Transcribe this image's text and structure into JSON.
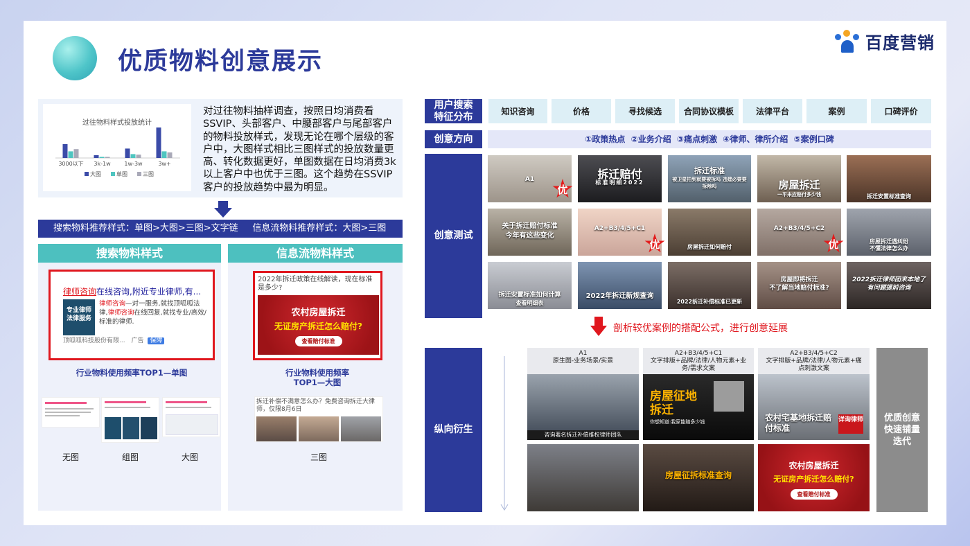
{
  "title": "优质物料创意展示",
  "logo": {
    "text": "百度营销"
  },
  "mini_chart": {
    "title": "过往物料样式投放统计",
    "legend": [
      "大图",
      "单图",
      "三图"
    ],
    "colors": [
      "#3b4ba8",
      "#4fc5c0",
      "#a9a9b8"
    ]
  },
  "chart_data": {
    "type": "bar",
    "title": "过往物料样式投放统计",
    "categories": [
      "3000以下",
      "3k-1w",
      "1w-3w",
      "3w+"
    ],
    "series": [
      {
        "name": "大图",
        "values": [
          25,
          5,
          17,
          55
        ]
      },
      {
        "name": "单图",
        "values": [
          12,
          2,
          7,
          12
        ]
      },
      {
        "name": "三图",
        "values": [
          16,
          2,
          6,
          10
        ]
      }
    ],
    "ylim": [
      0,
      60
    ],
    "legend": "bottom"
  },
  "description": "对过往物料抽样调查，按照日均消费看SSVIP、头部客户、中腰部客户与尾部客户的物料投放样式，发现无论在哪个层级的客户中，大图样式相比三图样式的投放数量更高、转化数据更好，单图数据在日均消费3k以上客户中也优于三图。这个趋势在SSVIP客户的投放趋势中最为明显。",
  "recommend": "搜索物料推荐样式：单图>大图>三图>文字链     信息流物料推荐样式：大图>三图",
  "search_panel": {
    "head": "搜索物料样式",
    "ad_title_red": "律师咨询",
    "ad_title_rest": "在线咨询,附近专业律师,有...",
    "ad_img_line1": "专业律师",
    "ad_img_line2": "法律服务",
    "ad_body_1": "律师咨询",
    "ad_body_2": "—对一服务,就找顶呱呱法律,",
    "ad_body_3": "律师咨询",
    "ad_body_4": "在线回复,就找专业/高效/标准的律师.",
    "ad_footer": "顶呱呱科技股份有限...",
    "ad_tag": "广告",
    "ad_badge": "保障",
    "caption": "行业物料使用频率TOP1—单图",
    "labels": [
      "无图",
      "组图",
      "大图"
    ]
  },
  "feed_panel": {
    "head": "信息流物料样式",
    "ad_text": "2022年拆迁政策在线解读，现在标准是多少?",
    "ad_banner_1": "农村房屋拆迁",
    "ad_banner_2": "无证房产拆迁怎么赔付?",
    "ad_banner_btn": "查看赔付标准",
    "caption_1": "行业物料使用频率",
    "caption_2": "TOP1—大图",
    "three_text": "拆迁补偿不满意怎么办？免费咨询拆迁大律师，仅限8月6日",
    "label": "三图"
  },
  "right": {
    "label_search": "用户搜索\n特征分布",
    "tags": [
      "知识咨询",
      "价格",
      "寻找候选",
      "合同协议模板",
      "法律平台",
      "案例",
      "口碑评价"
    ],
    "label_direction": "创意方向",
    "direction_text": "①政策热点 ②业务介绍 ③痛点刺激 ④律师、律所介绍 ⑤案例口碑",
    "label_test": "创意测试",
    "tests": [
      {
        "t1": "A1",
        "t2": "",
        "you": "优"
      },
      {
        "t1": "拆迁赔付",
        "t2": "标准明细2022"
      },
      {
        "t1": "拆迁标准",
        "t2": "被卫星拍到就要被拆吗 违建必要要拆除吗"
      },
      {
        "t1": "房屋拆迁",
        "t2": "一平米应赔付多少钱"
      },
      {
        "t1": "拆迁安置标准查询",
        "t2": ""
      },
      {
        "t1": "关于拆迁赔付标准",
        "t2": "今年有这些变化"
      },
      {
        "t1": "A2+B3/4/5+C1",
        "t2": "",
        "you": "优"
      },
      {
        "t1": "房屋拆迁如何赔付",
        "t2": ""
      },
      {
        "t1": "A2+B3/4/5+C2",
        "t2": "",
        "you": "优"
      },
      {
        "t1": "房屋拆迁遇纠纷",
        "t2": "不懂法律怎么办"
      },
      {
        "t1": "拆迁安置标准如何计算",
        "t2": "查看明细表"
      },
      {
        "t1": "2022年拆迁新规查询",
        "t2": ""
      },
      {
        "t1": "2022拆迁补偿标准",
        "t2": "已更新"
      },
      {
        "t1": "房屋即将拆迁",
        "t2": "不了解当地赔付标准?"
      },
      {
        "t1": "2022拆迁律师团来本地了",
        "t2": "有问题提前咨询"
      }
    ],
    "analysis": "剖析较优案例的搭配公式，进行创意延展",
    "label_vertical": "纵向衍生",
    "cols": [
      {
        "h1": "A1",
        "h2": "原生图-业务场景/实景"
      },
      {
        "h1": "A2+B3/4/5+C1",
        "h2": "文字排版+品牌/法律/人物元素+业务/需求文案"
      },
      {
        "h1": "A2+B3/4/5+C2",
        "h2": "文字排版+品牌/法律/人物元素+痛点刺激文案"
      }
    ],
    "derived": [
      {
        "t1": "",
        "t2": "咨询著名拆迁补偿维权律师团队"
      },
      {
        "t1": "房屋征地拆迁",
        "t2": "你想知道:我家能赔多少钱"
      },
      {
        "t1": "农村宅基地拆迁赔付标准",
        "t2": "详询律师"
      },
      {
        "t1": "",
        "t2": ""
      },
      {
        "t1": "房屋征拆标准查询",
        "t2": ""
      },
      {
        "t1": "农村房屋拆迁",
        "t2": "无证房产拆迁怎么赔付?",
        "t3": "查看赔付标准"
      }
    ],
    "grey": "优质创意\n快速铺量\n迭代"
  }
}
